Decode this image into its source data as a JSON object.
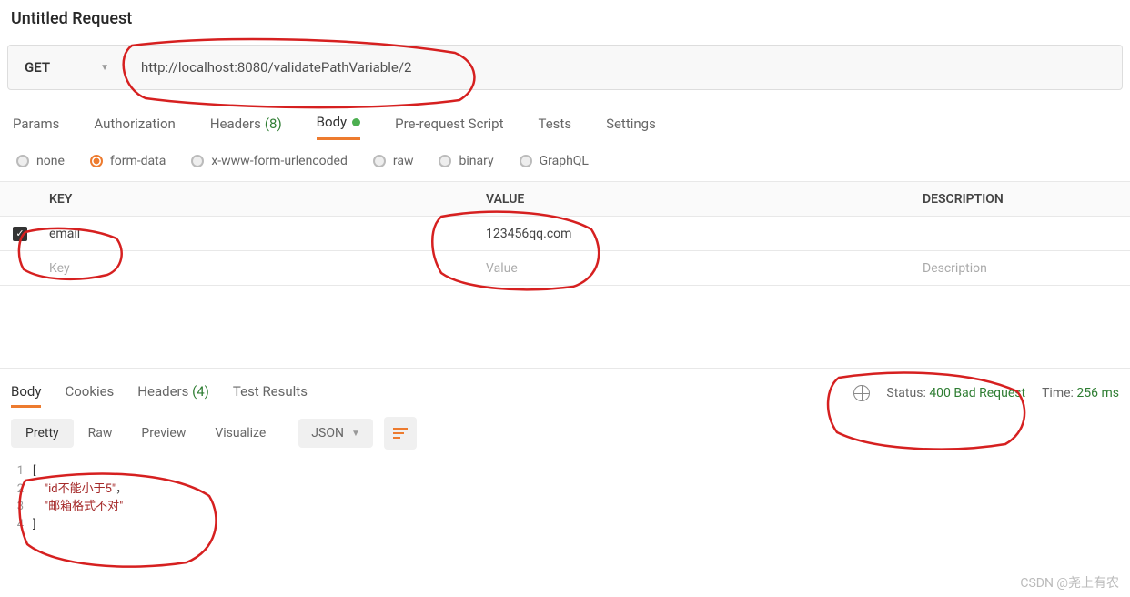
{
  "title": "Untitled Request",
  "request": {
    "method": "GET",
    "url": "http://localhost:8080/validatePathVariable/2"
  },
  "tabs": {
    "params": "Params",
    "auth": "Authorization",
    "headers_label": "Headers",
    "headers_count": "(8)",
    "body": "Body",
    "prereq": "Pre-request Script",
    "tests": "Tests",
    "settings": "Settings"
  },
  "body_types": {
    "none": "none",
    "form_data": "form-data",
    "urlencoded": "x-www-form-urlencoded",
    "raw": "raw",
    "binary": "binary",
    "graphql": "GraphQL"
  },
  "table": {
    "key_header": "KEY",
    "value_header": "VALUE",
    "desc_header": "DESCRIPTION",
    "rows": [
      {
        "key": "email",
        "value": "123456qq.com",
        "desc": ""
      }
    ],
    "ph_key": "Key",
    "ph_value": "Value",
    "ph_desc": "Description"
  },
  "response_tabs": {
    "body": "Body",
    "cookies": "Cookies",
    "headers_label": "Headers",
    "headers_count": "(4)",
    "test_results": "Test Results"
  },
  "response_meta": {
    "status_label": "Status:",
    "status_value": "400 Bad Request",
    "time_label": "Time:",
    "time_value": "256 ms"
  },
  "view_modes": {
    "pretty": "Pretty",
    "raw": "Raw",
    "preview": "Preview",
    "visualize": "Visualize",
    "format": "JSON"
  },
  "code": {
    "l1": "[",
    "l2_str": "\"id不能小于5\"",
    "l2_comma": "，",
    "l3_str": "\"邮箱格式不对\"",
    "l4": "]",
    "n1": "1",
    "n2": "2",
    "n3": "3",
    "n4": "4"
  },
  "watermark": "CSDN @尧上有农"
}
